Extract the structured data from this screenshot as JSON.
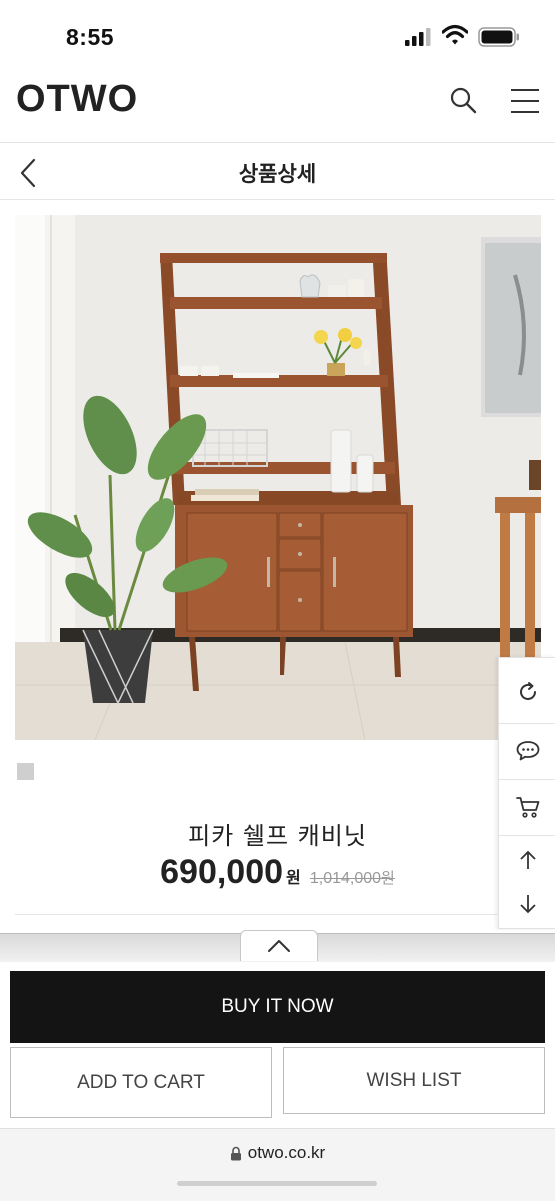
{
  "status_bar": {
    "time": "8:55"
  },
  "header": {
    "logo": "OTWO"
  },
  "subheader": {
    "title": "상품상세"
  },
  "product": {
    "name": "피카 쉘프 캐비닛",
    "price": "690,000",
    "currency": "원",
    "original_price": "1,014,000",
    "original_currency": "원"
  },
  "side_menu": {
    "items": [
      "refresh-icon",
      "chat-icon",
      "cart-icon",
      "arrow-up-icon",
      "arrow-down-icon"
    ]
  },
  "actions": {
    "buy_now": "BUY IT NOW",
    "add_to_cart": "ADD TO CART",
    "wish_list": "WISH LIST"
  },
  "browser": {
    "url": "otwo.co.kr"
  },
  "colors": {
    "buy_button": "#141414",
    "wood": "#9a5530",
    "background": "#ffffff"
  }
}
